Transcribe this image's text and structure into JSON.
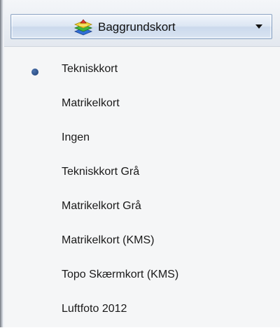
{
  "toolbar": {
    "background_map_button": {
      "label": "Baggrundskort",
      "icon": "map-layers-icon",
      "dropdown_icon": "chevron-down-icon"
    }
  },
  "menu": {
    "selected_index": 0,
    "items": [
      {
        "label": "Tekniskkort",
        "selected": true
      },
      {
        "label": "Matrikelkort",
        "selected": false
      },
      {
        "label": "Ingen",
        "selected": false
      },
      {
        "label": "Tekniskkort Grå",
        "selected": false
      },
      {
        "label": "Matrikelkort Grå",
        "selected": false
      },
      {
        "label": "Matrikelkort (KMS)",
        "selected": false
      },
      {
        "label": "Topo Skærmkort (KMS)",
        "selected": false
      },
      {
        "label": "Luftfoto 2012",
        "selected": false
      }
    ]
  },
  "colors": {
    "selected_dot": "#1d3f75",
    "button_border": "#8fa6c4",
    "menu_background": "#f5f6f7"
  }
}
